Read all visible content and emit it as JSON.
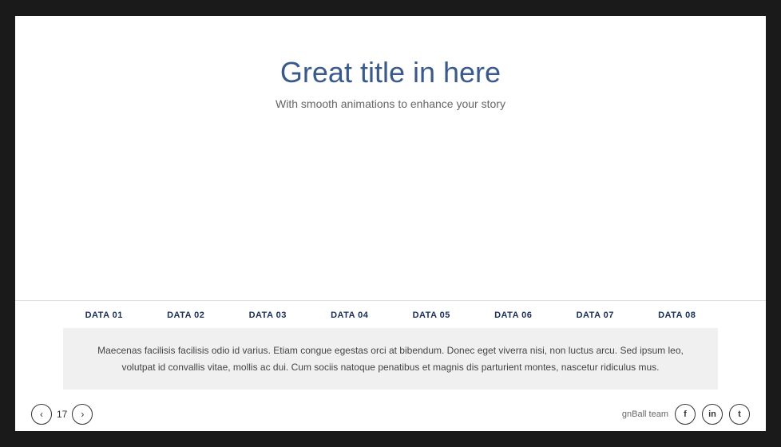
{
  "slide": {
    "title": "Great title in here",
    "subtitle": "With smooth animations to enhance your story",
    "data_tabs": [
      "DATA 01",
      "DATA 02",
      "DATA 03",
      "DATA 04",
      "DATA 05",
      "DATA 06",
      "DATA 07",
      "DATA 08"
    ],
    "description": "Maecenas facilisis facilisis odio id varius. Etiam congue egestas orci at bibendum. Donec eget viverra nisi, non luctus arcu. Sed ipsum leo, volutpat id convallis vitae, mollis ac dui. Cum sociis natoque penatibus et magnis dis parturient montes, nascetur ridiculus mus.",
    "footer": {
      "prev_label": "‹",
      "page_number": "17",
      "next_label": "›",
      "brand": "gnBall team",
      "social": [
        "f",
        "in",
        "t"
      ]
    }
  }
}
